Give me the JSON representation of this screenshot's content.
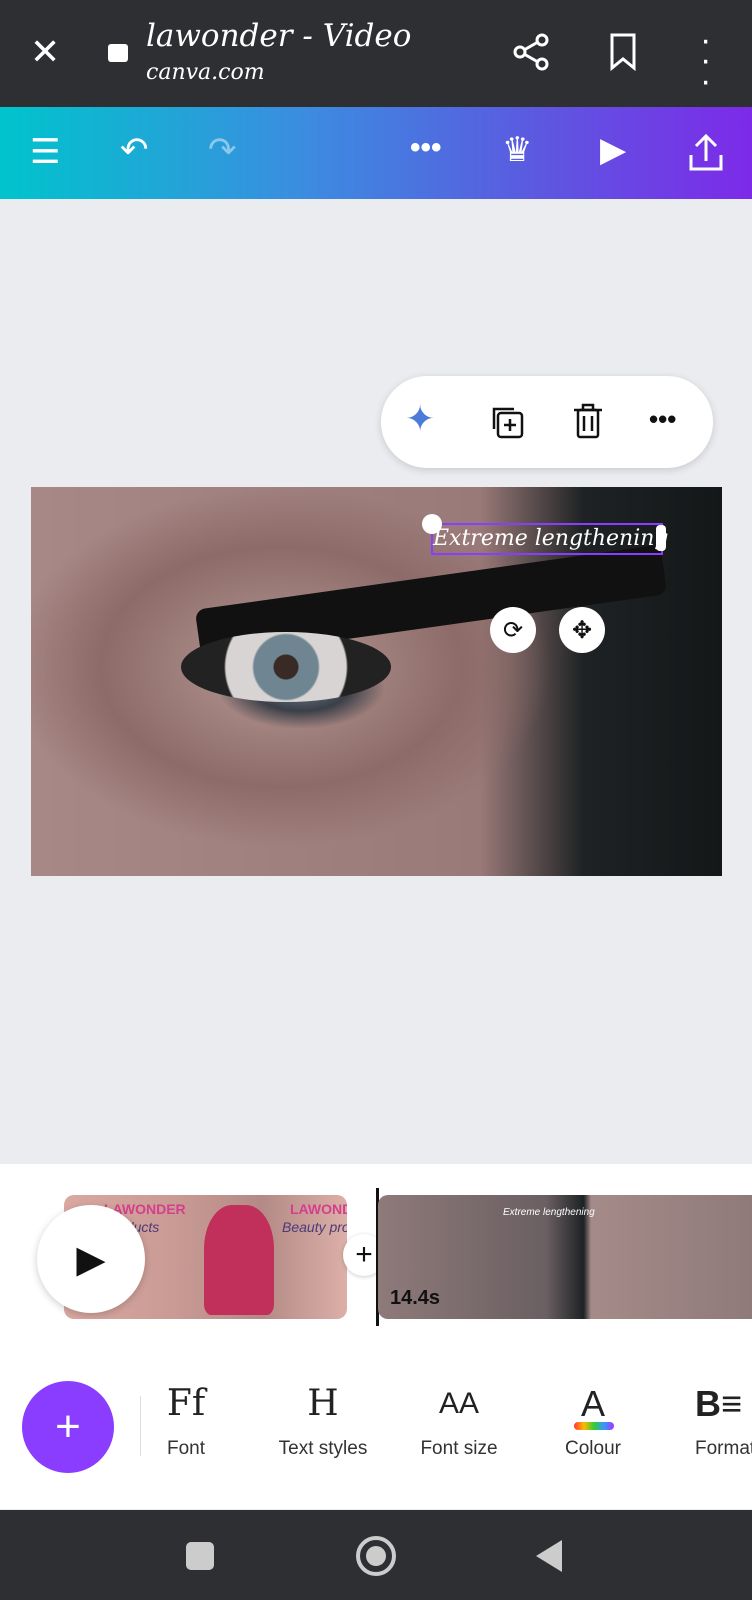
{
  "browser": {
    "title": "lawonder - Video",
    "url": "canva.com"
  },
  "toolbar": {
    "icons": [
      "menu-icon",
      "undo-icon",
      "redo-icon",
      "more-icon",
      "crown-icon",
      "play-icon",
      "share-icon"
    ]
  },
  "floating_menu": {
    "icons": [
      "magic-sparkle-icon",
      "duplicate-icon",
      "trash-icon",
      "more-icon"
    ]
  },
  "canvas": {
    "selected_text": "Extreme lengthening"
  },
  "timeline": {
    "clip1": {
      "texts": [
        "LAWONDER",
        "Products",
        "LAWONDER",
        "Beauty products"
      ]
    },
    "clip2": {
      "duration": "14.4s",
      "overlay_text": "Extreme lengthening"
    }
  },
  "bottom_tools": [
    {
      "glyph": "Ff",
      "label": "Font"
    },
    {
      "glyph": "H",
      "label": "Text styles"
    },
    {
      "glyph": "AA",
      "label": "Font size"
    },
    {
      "glyph": "A",
      "label": "Colour"
    },
    {
      "glyph": "B≡",
      "label": "Format"
    }
  ],
  "colors": {
    "accent": "#8b3dff",
    "gradient_start": "#00c4cc",
    "gradient_end": "#7d2ae8"
  }
}
